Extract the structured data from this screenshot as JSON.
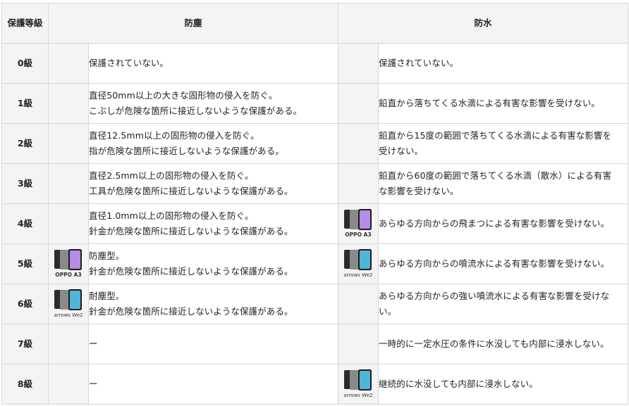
{
  "header": {
    "grade": "保護等級",
    "dust": "防塵",
    "water": "防水"
  },
  "rows": [
    {
      "grade": "0級",
      "dust": [
        "保護されていない。"
      ],
      "dust_phone": "",
      "water": [
        "保護されていない。"
      ],
      "water_phone": ""
    },
    {
      "grade": "1級",
      "dust": [
        "直径50mm以上の大きな固形物の侵入を防ぐ。",
        "こぶしが危険な箇所に接近しないような保護がある。"
      ],
      "dust_phone": "",
      "water": [
        "鉛直から落ちてくる水滴による有害な影響を受けない。"
      ],
      "water_phone": ""
    },
    {
      "grade": "2級",
      "dust": [
        "直径12.5mm以上の固形物の侵入を防ぐ。",
        "指が危険な箇所に接近しないような保護がある。"
      ],
      "dust_phone": "",
      "water": [
        "鉛直から15度の範囲で落ちてくる水滴による有害な影響を",
        "受けない。"
      ],
      "water_phone": ""
    },
    {
      "grade": "3級",
      "dust": [
        "直径2.5mm以上の固形物の侵入を防ぐ。",
        "工具が危険な箇所に接近しないような保護がある。"
      ],
      "dust_phone": "",
      "water": [
        "鉛直から60度の範囲で落ちてくる水滴（散水）による有害",
        "な影響を受けない。"
      ],
      "water_phone": ""
    },
    {
      "grade": "4級",
      "dust": [
        "直径1.0mm以上の固形物の侵入を防ぐ。",
        "針金が危険な箇所に接近しないような保護がある。"
      ],
      "dust_phone": "",
      "water": [
        "あらゆる方向からの飛まつによる有害な影響を受けない。"
      ],
      "water_phone": "OPPO A3"
    },
    {
      "grade": "5級",
      "dust": [
        "防塵型。",
        "針金が危険な箇所に接近しないような保護がある。"
      ],
      "dust_phone": "OPPO A3",
      "water": [
        "あらゆる方向からの噴流水による有害な影響を受けない。"
      ],
      "water_phone": "arrows We2"
    },
    {
      "grade": "6級",
      "dust": [
        "耐塵型。",
        "針金が危険な箇所に接近しないような保護がある。"
      ],
      "dust_phone": "arrows We2",
      "water": [
        "あらゆる方向からの強い噴流水による有害な影響を受けな",
        "い。"
      ],
      "water_phone": ""
    },
    {
      "grade": "7級",
      "dust": [
        "ー"
      ],
      "dust_phone": "",
      "water": [
        "一時的に一定水圧の条件に水没しても内部に浸水しない。"
      ],
      "water_phone": ""
    },
    {
      "grade": "8級",
      "dust": [
        "ー"
      ],
      "dust_phone": "",
      "water": [
        "継続的に水没しても内部に浸水しない。"
      ],
      "water_phone": "arrows We2"
    }
  ]
}
